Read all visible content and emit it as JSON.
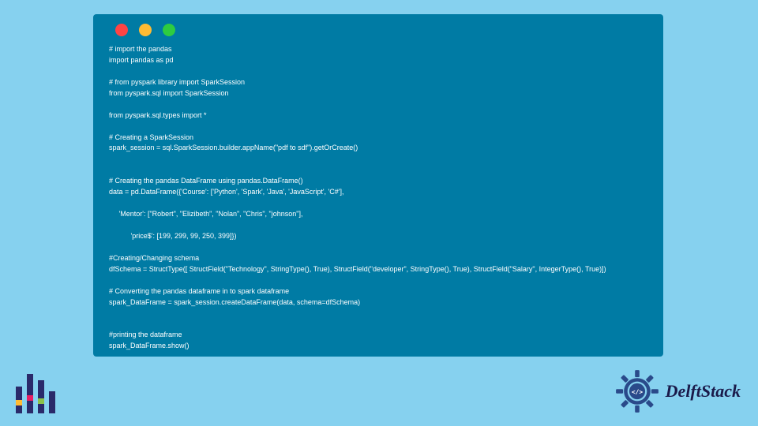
{
  "code": {
    "lines": [
      "# import the pandas",
      "import pandas as pd",
      "",
      "# from pyspark library import SparkSession",
      "from pyspark.sql import SparkSession",
      "",
      "from pyspark.sql.types import *",
      "",
      "# Creating a SparkSession",
      "spark_session = sql.SparkSession.builder.appName(\"pdf to sdf\").getOrCreate()",
      "",
      "",
      "# Creating the pandas DataFrame using pandas.DataFrame()",
      "data = pd.DataFrame({'Course': ['Python', 'Spark', 'Java', 'JavaScript', 'C#'],",
      "",
      "     'Mentor': [\"Robert\", \"Elizibeth\", \"Nolan\", \"Chris\", \"johnson\"],",
      "",
      "           'price$': [199, 299, 99, 250, 399]})",
      "",
      "#Creating/Changing schema",
      "dfSchema = StructType([ StructField(\"Technology\", StringType(), True), StructField(\"developer\", StringType(), True), StructField(\"Salary\", IntegerType(), True)])",
      "",
      "# Converting the pandas dataframe in to spark dataframe",
      "spark_DataFrame = spark_session.createDataFrame(data, schema=dfSchema)",
      "",
      "",
      "#printing the dataframe",
      "spark_DataFrame.show()"
    ]
  },
  "branding": {
    "right_text": "DelftStack"
  }
}
